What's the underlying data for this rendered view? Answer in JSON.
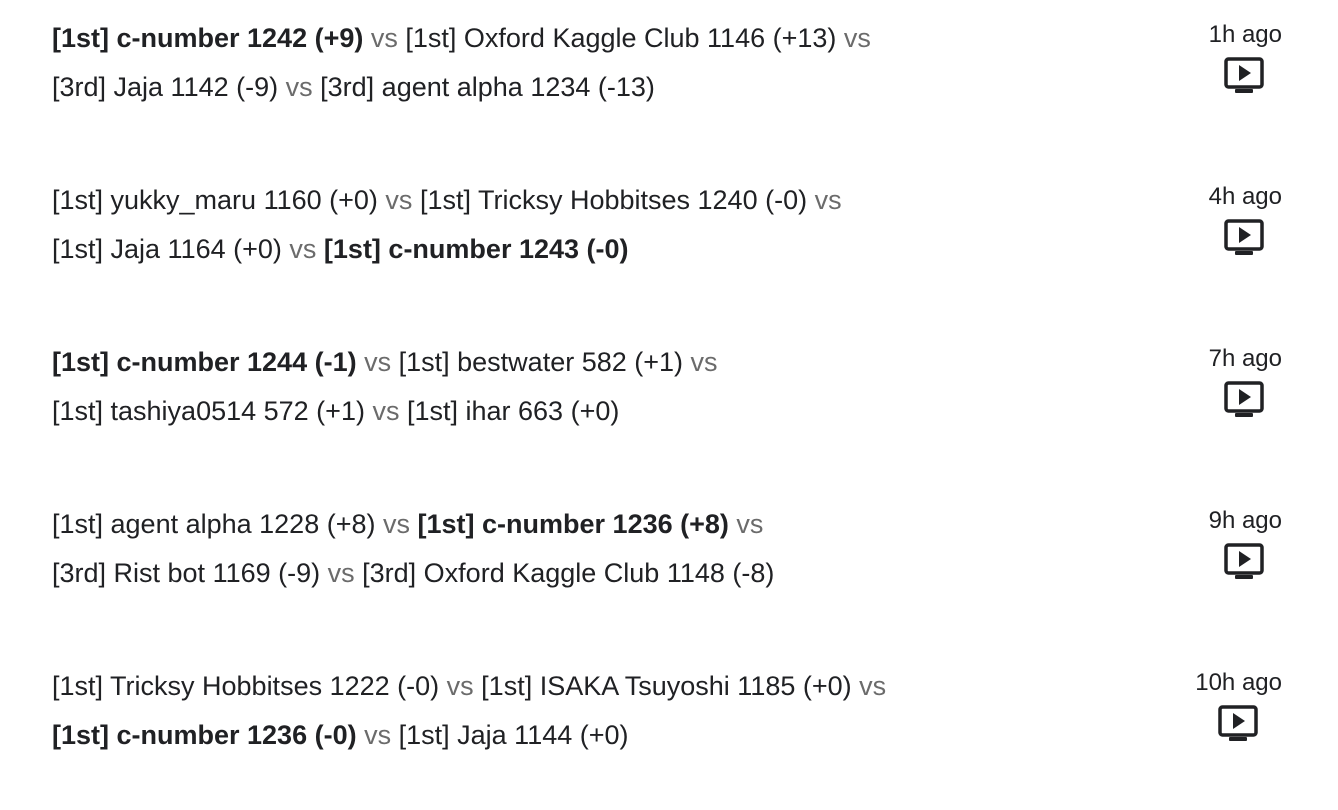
{
  "episodes": [
    {
      "lines": [
        [
          {
            "kind": "team",
            "text": "[1st] c-number 1242 (+9)",
            "highlight": true
          },
          {
            "kind": "vs",
            "text": "vs"
          },
          {
            "kind": "team",
            "text": "[1st] Oxford Kaggle Club 1146 (+13)",
            "highlight": false
          },
          {
            "kind": "vs",
            "text": "vs"
          }
        ],
        [
          {
            "kind": "team",
            "text": "[3rd] Jaja 1142 (-9)",
            "highlight": false
          },
          {
            "kind": "vs",
            "text": "vs"
          },
          {
            "kind": "team",
            "text": "[3rd] agent alpha 1234 (-13)",
            "highlight": false
          }
        ]
      ],
      "time": "1h ago",
      "icon": "play-replay-icon"
    },
    {
      "lines": [
        [
          {
            "kind": "team",
            "text": "[1st] yukky_maru 1160 (+0)",
            "highlight": false
          },
          {
            "kind": "vs",
            "text": "vs"
          },
          {
            "kind": "team",
            "text": "[1st] Tricksy Hobbitses 1240 (-0)",
            "highlight": false
          },
          {
            "kind": "vs",
            "text": "vs"
          }
        ],
        [
          {
            "kind": "team",
            "text": "[1st] Jaja 1164 (+0)",
            "highlight": false
          },
          {
            "kind": "vs",
            "text": "vs"
          },
          {
            "kind": "team",
            "text": "[1st] c-number 1243 (-0)",
            "highlight": true
          }
        ]
      ],
      "time": "4h ago",
      "icon": "play-replay-icon"
    },
    {
      "lines": [
        [
          {
            "kind": "team",
            "text": "[1st] c-number 1244 (-1)",
            "highlight": true
          },
          {
            "kind": "vs",
            "text": "vs"
          },
          {
            "kind": "team",
            "text": "[1st] bestwater 582 (+1)",
            "highlight": false
          },
          {
            "kind": "vs",
            "text": "vs"
          }
        ],
        [
          {
            "kind": "team",
            "text": "[1st] tashiya0514 572 (+1)",
            "highlight": false
          },
          {
            "kind": "vs",
            "text": "vs"
          },
          {
            "kind": "team",
            "text": "[1st] ihar 663 (+0)",
            "highlight": false
          }
        ]
      ],
      "time": "7h ago",
      "icon": "play-replay-icon"
    },
    {
      "lines": [
        [
          {
            "kind": "team",
            "text": "[1st] agent alpha 1228 (+8)",
            "highlight": false
          },
          {
            "kind": "vs",
            "text": "vs"
          },
          {
            "kind": "team",
            "text": "[1st] c-number 1236 (+8)",
            "highlight": true
          },
          {
            "kind": "vs",
            "text": "vs"
          }
        ],
        [
          {
            "kind": "team",
            "text": "[3rd] Rist bot 1169 (-9)",
            "highlight": false
          },
          {
            "kind": "vs",
            "text": "vs"
          },
          {
            "kind": "team",
            "text": "[3rd] Oxford Kaggle Club 1148 (-8)",
            "highlight": false
          }
        ]
      ],
      "time": "9h ago",
      "icon": "play-replay-icon"
    },
    {
      "lines": [
        [
          {
            "kind": "team",
            "text": "[1st] Tricksy Hobbitses 1222 (-0)",
            "highlight": false
          },
          {
            "kind": "vs",
            "text": "vs"
          },
          {
            "kind": "team",
            "text": "[1st] ISAKA Tsuyoshi 1185 (+0)",
            "highlight": false
          },
          {
            "kind": "vs",
            "text": "vs"
          }
        ],
        [
          {
            "kind": "team",
            "text": "[1st] c-number 1236 (-0)",
            "highlight": true
          },
          {
            "kind": "vs",
            "text": "vs"
          },
          {
            "kind": "team",
            "text": "[1st] Jaja 1144 (+0)",
            "highlight": false
          }
        ]
      ],
      "time": "10h ago",
      "icon": "play-replay-icon"
    }
  ]
}
